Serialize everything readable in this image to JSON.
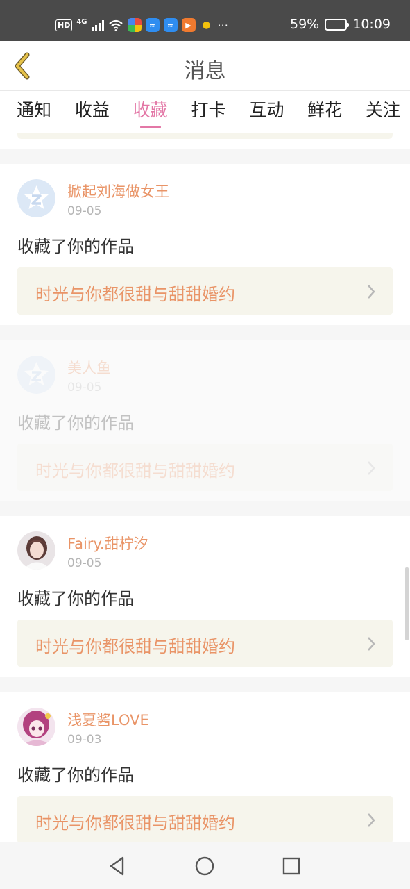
{
  "status_bar": {
    "hd": "HD",
    "network": "4G",
    "battery": "59%",
    "battery_level": 0.59,
    "time": "10:09",
    "more": "···",
    "icons": [
      "hd-icon",
      "signal-icon",
      "wifi-icon",
      "app-icon",
      "app-icon",
      "app-icon",
      "app-icon",
      "app-icon"
    ]
  },
  "header": {
    "back_icon": "chevron-left-icon",
    "title": "消息"
  },
  "tabs": [
    {
      "label": "通知",
      "active": false
    },
    {
      "label": "收益",
      "active": false
    },
    {
      "label": "收藏",
      "active": true
    },
    {
      "label": "打卡",
      "active": false
    },
    {
      "label": "互动",
      "active": false
    },
    {
      "label": "鲜花",
      "active": false
    },
    {
      "label": "关注",
      "active": false
    }
  ],
  "items": [
    {
      "username": "掀起刘海做女王",
      "date": "09-05",
      "action": "收藏了你的作品",
      "work_title": "时光与你都很甜与甜甜婚约",
      "avatar": "default-avatar",
      "faded": false
    },
    {
      "username": "美人鱼",
      "date": "09-05",
      "action": "收藏了你的作品",
      "work_title": "时光与你都很甜与甜甜婚约",
      "avatar": "default-avatar",
      "faded": true
    },
    {
      "username": "Fairy.甜柠汐",
      "date": "09-05",
      "action": "收藏了你的作品",
      "work_title": "时光与你都很甜与甜甜婚约",
      "avatar": "user-photo",
      "faded": false
    },
    {
      "username": "浅夏酱LOVE",
      "date": "09-03",
      "action": "收藏了你的作品",
      "work_title": "时光与你都很甜与甜甜婚约",
      "avatar": "anime-avatar",
      "faded": false
    }
  ],
  "colors": {
    "accent": "#e377a6",
    "username": "#e99467",
    "link_bg": "#f6f5ec",
    "back_icon": "#d9b23c"
  },
  "nav_bar": {
    "back": "triangle-back-icon",
    "home": "circle-home-icon",
    "recents": "square-recents-icon"
  }
}
